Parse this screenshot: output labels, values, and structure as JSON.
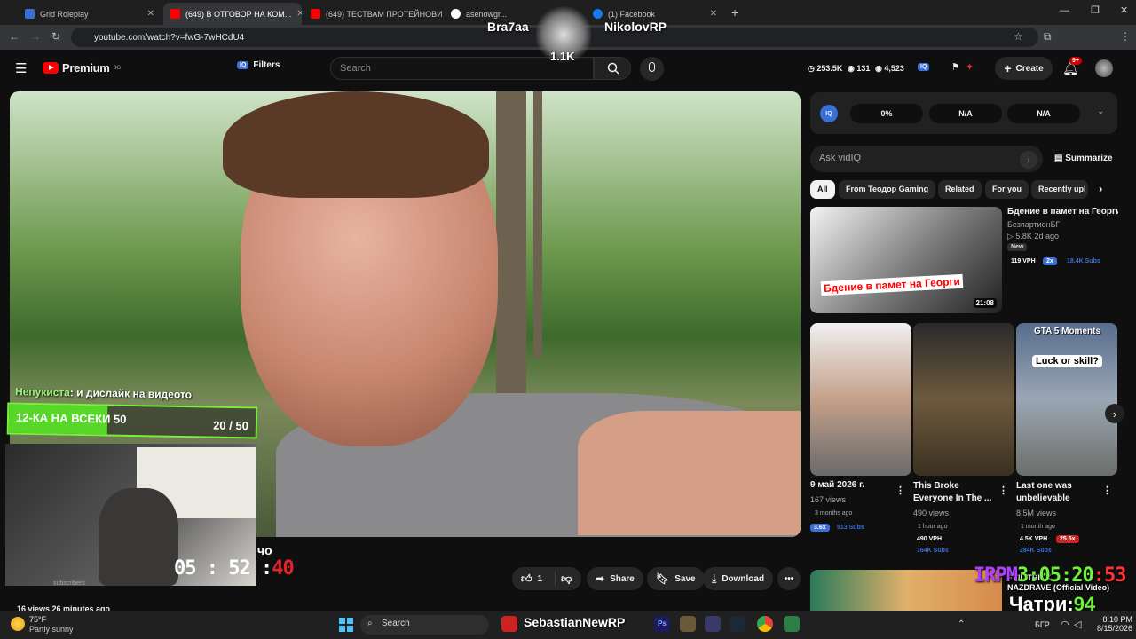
{
  "browser": {
    "tabs": [
      {
        "title": "Grid Roleplay",
        "active": false
      },
      {
        "title": "(649) В ОТГОВОР НА КОМ...",
        "active": true
      },
      {
        "title": "(649) ТЕСТВАМ ПРОТЕЙНОВИ...",
        "active": false
      },
      {
        "title": "asenowgr...",
        "active": false
      },
      {
        "title": "(1) Facebook",
        "active": false
      }
    ],
    "url": "youtube.com/watch?v=fwG-7wHCdU4"
  },
  "youtube": {
    "logo": "Premium",
    "logo_region": "BG",
    "filters_label": "Filters",
    "search_placeholder": "Search",
    "stats": {
      "views": "253.5K",
      "viewers": "131",
      "watch": "4,523"
    },
    "create_label": "Create",
    "notif_count": "9+"
  },
  "player": {
    "overlay_chat_name": "Непукиста",
    "overlay_chat_msg": ": и дислайк на видеото",
    "goal_label": "12-КА НА ВСЕКИ 50",
    "goal_count": "20 / 50",
    "goal_fraction": 0.4,
    "timer_main": "05 : 52 :",
    "timer_red": "40",
    "subtitle_fragment": "чо"
  },
  "actions": {
    "like_count": "1",
    "share": "Share",
    "save": "Save",
    "download": "Download"
  },
  "meta": {
    "views_time": "16 views  26 minutes ago",
    "subscribers": "subscribers"
  },
  "overlays": {
    "name_left": "Bra7aa",
    "name_right": "NikolovRP",
    "logo_count": "1.1K",
    "rpm_label": "IRPM",
    "rpm_time": "3:05:20",
    "rpm_red": ":53",
    "chatri_label": "Чатри:",
    "chatri_value": "94",
    "bottom_title_1": "EVIL TRICK...",
    "bottom_title_2": "NAZDRAVE (Official Video)"
  },
  "vidiq": {
    "badge": "IQ",
    "pills": [
      "0%",
      "N/A",
      "N/A"
    ],
    "ask_placeholder": "Ask vidIQ",
    "summarize": "Summarize"
  },
  "chips": [
    "All",
    "From Теодор Gaming",
    "Related",
    "For you",
    "Recently upl"
  ],
  "featured": {
    "title": "Бдение в памет на Георги",
    "thumb_caption": "Бдение в памет на Георги",
    "channel": "БезпартиенБГ",
    "meta": "5.8K  2d ago",
    "badge_new": "New",
    "vph": "119 VPH",
    "mult": "2x",
    "subs": "18.4K Subs",
    "duration": "21:08"
  },
  "shorts": [
    {
      "title": "9 май 2026 г.",
      "views": "167 views",
      "age": "3 months ago",
      "mult": "3.6x",
      "subs": "513 Subs"
    },
    {
      "title": "This Broke Everyone In The ...",
      "views": "490 views",
      "age": "1 hour ago",
      "vph": "490 VPH",
      "subs": "164K Subs"
    },
    {
      "title": "Last one was unbelievable",
      "views": "8.5M views",
      "age": "1 month ago",
      "vph": "4.5K VPH",
      "mult": "25.5x",
      "subs": "284K Subs",
      "thumb_title": "GTA 5 Moments",
      "thumb_q": "Luck or skill?"
    }
  ],
  "taskbar": {
    "weather_temp": "75°F",
    "weather_desc": "Partly sunny",
    "search": "Search",
    "overlay_name": "SebastianNewRP",
    "lang": "БГР",
    "time": "8:10 PM",
    "date": "8/15/2026"
  }
}
